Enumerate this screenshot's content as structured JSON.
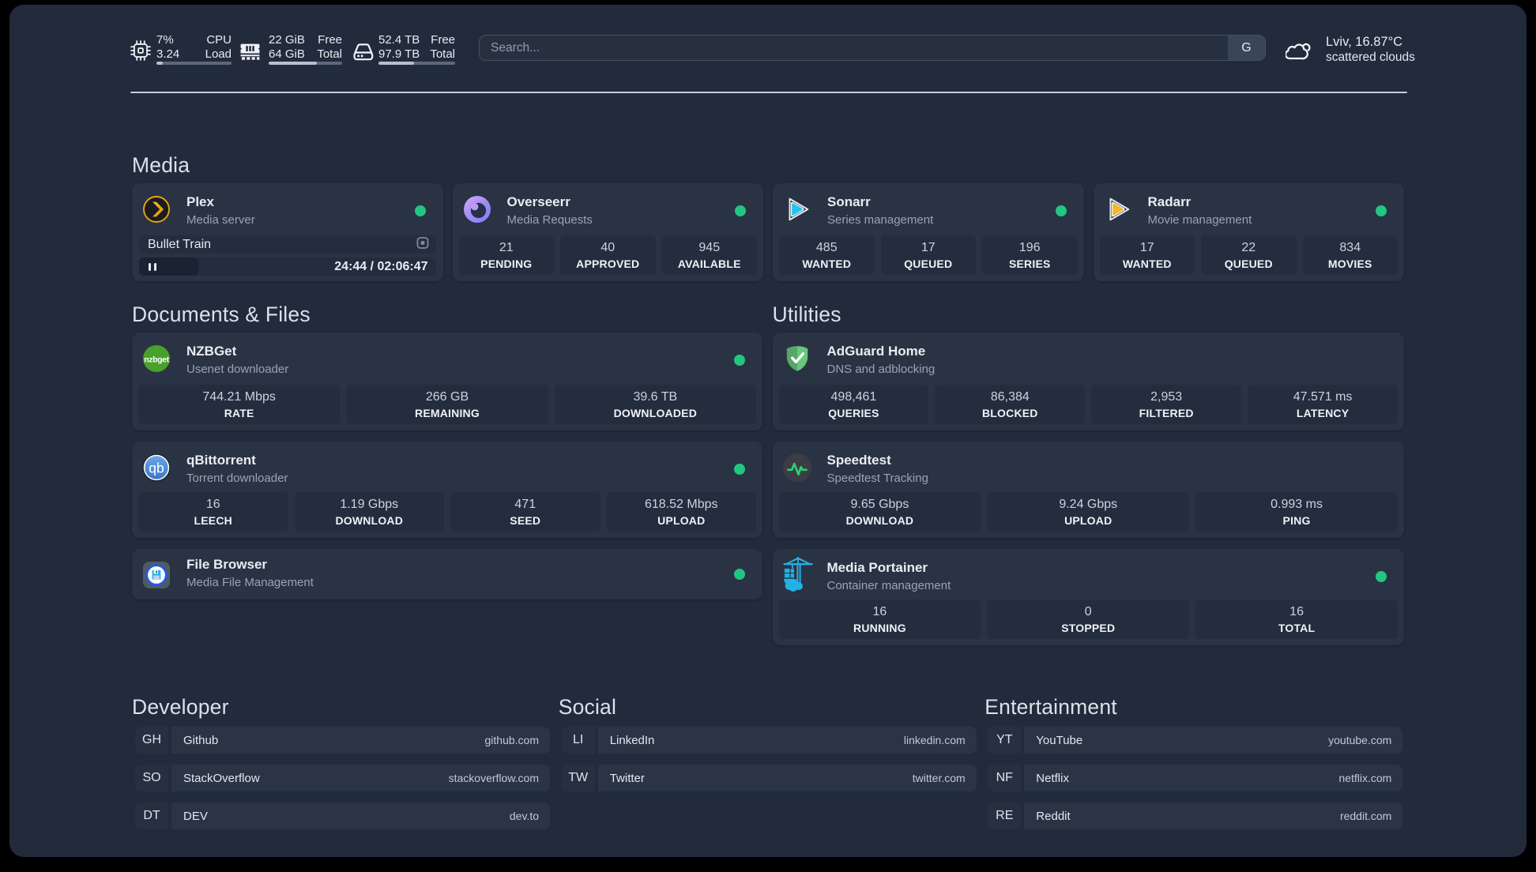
{
  "topbar": {
    "monitors": [
      {
        "icon": "cpu-icon",
        "col1": [
          "7%",
          "3.24"
        ],
        "col2": [
          "CPU",
          "Load"
        ],
        "percent": 8
      },
      {
        "icon": "memory-icon",
        "col1": [
          "22 GiB",
          "64 GiB"
        ],
        "col2": [
          "Free",
          "Total"
        ],
        "percent": 66
      },
      {
        "icon": "disk-icon",
        "col1": [
          "52.4 TB",
          "97.9 TB"
        ],
        "col2": [
          "Free",
          "Total"
        ],
        "percent": 46
      }
    ],
    "search": {
      "placeholder": "Search...",
      "button_label": "G"
    },
    "weather": {
      "icon": "cloud-icon",
      "location": "Lviv, 16.87°C",
      "condition": "scattered clouds"
    }
  },
  "groups": [
    {
      "title": "Media",
      "services": [
        {
          "name": "Plex",
          "subtitle": "Media server",
          "icon": "plex-logo",
          "online": true,
          "media_player": {
            "now_playing": "Bullet Train",
            "time_display": "24:44 / 02:06:47",
            "progress_percent": 20
          }
        },
        {
          "name": "Overseerr",
          "subtitle": "Media Requests",
          "icon": "overseerr-logo",
          "online": true,
          "stats": [
            {
              "value": "21",
              "label": "PENDING"
            },
            {
              "value": "40",
              "label": "APPROVED"
            },
            {
              "value": "945",
              "label": "AVAILABLE"
            }
          ]
        },
        {
          "name": "Sonarr",
          "subtitle": "Series management",
          "icon": "sonarr-logo",
          "online": true,
          "stats": [
            {
              "value": "485",
              "label": "WANTED"
            },
            {
              "value": "17",
              "label": "QUEUED"
            },
            {
              "value": "196",
              "label": "SERIES"
            }
          ]
        },
        {
          "name": "Radarr",
          "subtitle": "Movie management",
          "icon": "radarr-logo",
          "online": true,
          "stats": [
            {
              "value": "17",
              "label": "WANTED"
            },
            {
              "value": "22",
              "label": "QUEUED"
            },
            {
              "value": "834",
              "label": "MOVIES"
            }
          ]
        }
      ]
    },
    {
      "title": "Documents & Files",
      "services": [
        {
          "name": "NZBGet",
          "subtitle": "Usenet downloader",
          "icon": "nzbget-logo",
          "online": true,
          "stats": [
            {
              "value": "744.21 Mbps",
              "label": "RATE"
            },
            {
              "value": "266 GB",
              "label": "REMAINING"
            },
            {
              "value": "39.6 TB",
              "label": "DOWNLOADED"
            }
          ]
        },
        {
          "name": "qBittorrent",
          "subtitle": "Torrent downloader",
          "icon": "qbittorrent-logo",
          "online": true,
          "stats": [
            {
              "value": "16",
              "label": "LEECH"
            },
            {
              "value": "1.19 Gbps",
              "label": "DOWNLOAD"
            },
            {
              "value": "471",
              "label": "SEED"
            },
            {
              "value": "618.52 Mbps",
              "label": "UPLOAD"
            }
          ]
        },
        {
          "name": "File Browser",
          "subtitle": "Media File Management",
          "icon": "filebrowser-logo",
          "online": true,
          "stats": []
        }
      ]
    },
    {
      "title": "Utilities",
      "services": [
        {
          "name": "AdGuard Home",
          "subtitle": "DNS and adblocking",
          "icon": "adguard-logo",
          "online": null,
          "stats": [
            {
              "value": "498,461",
              "label": "QUERIES"
            },
            {
              "value": "86,384",
              "label": "BLOCKED"
            },
            {
              "value": "2,953",
              "label": "FILTERED"
            },
            {
              "value": "47.571 ms",
              "label": "LATENCY"
            }
          ]
        },
        {
          "name": "Speedtest",
          "subtitle": "Speedtest Tracking",
          "icon": "speedtest-logo",
          "online": null,
          "stats": [
            {
              "value": "9.65 Gbps",
              "label": "DOWNLOAD"
            },
            {
              "value": "9.24 Gbps",
              "label": "UPLOAD"
            },
            {
              "value": "0.993 ms",
              "label": "PING"
            }
          ]
        },
        {
          "name": "Media Portainer",
          "subtitle": "Container management",
          "icon": "portainer-logo",
          "online": true,
          "stats": [
            {
              "value": "16",
              "label": "RUNNING"
            },
            {
              "value": "0",
              "label": "STOPPED"
            },
            {
              "value": "16",
              "label": "TOTAL"
            }
          ]
        }
      ]
    }
  ],
  "bookmark_groups": [
    {
      "title": "Developer",
      "bookmarks": [
        {
          "abbr": "GH",
          "name": "Github",
          "url": "github.com"
        },
        {
          "abbr": "SO",
          "name": "StackOverflow",
          "url": "stackoverflow.com"
        },
        {
          "abbr": "DT",
          "name": "DEV",
          "url": "dev.to"
        }
      ]
    },
    {
      "title": "Social",
      "bookmarks": [
        {
          "abbr": "LI",
          "name": "LinkedIn",
          "url": "linkedin.com"
        },
        {
          "abbr": "TW",
          "name": "Twitter",
          "url": "twitter.com"
        }
      ]
    },
    {
      "title": "Entertainment",
      "bookmarks": [
        {
          "abbr": "YT",
          "name": "YouTube",
          "url": "youtube.com"
        },
        {
          "abbr": "NF",
          "name": "Netflix",
          "url": "netflix.com"
        },
        {
          "abbr": "RE",
          "name": "Reddit",
          "url": "reddit.com"
        }
      ]
    }
  ],
  "colors": {
    "status_online": "#22c581",
    "accent_progress": "#b6c0cf"
  }
}
